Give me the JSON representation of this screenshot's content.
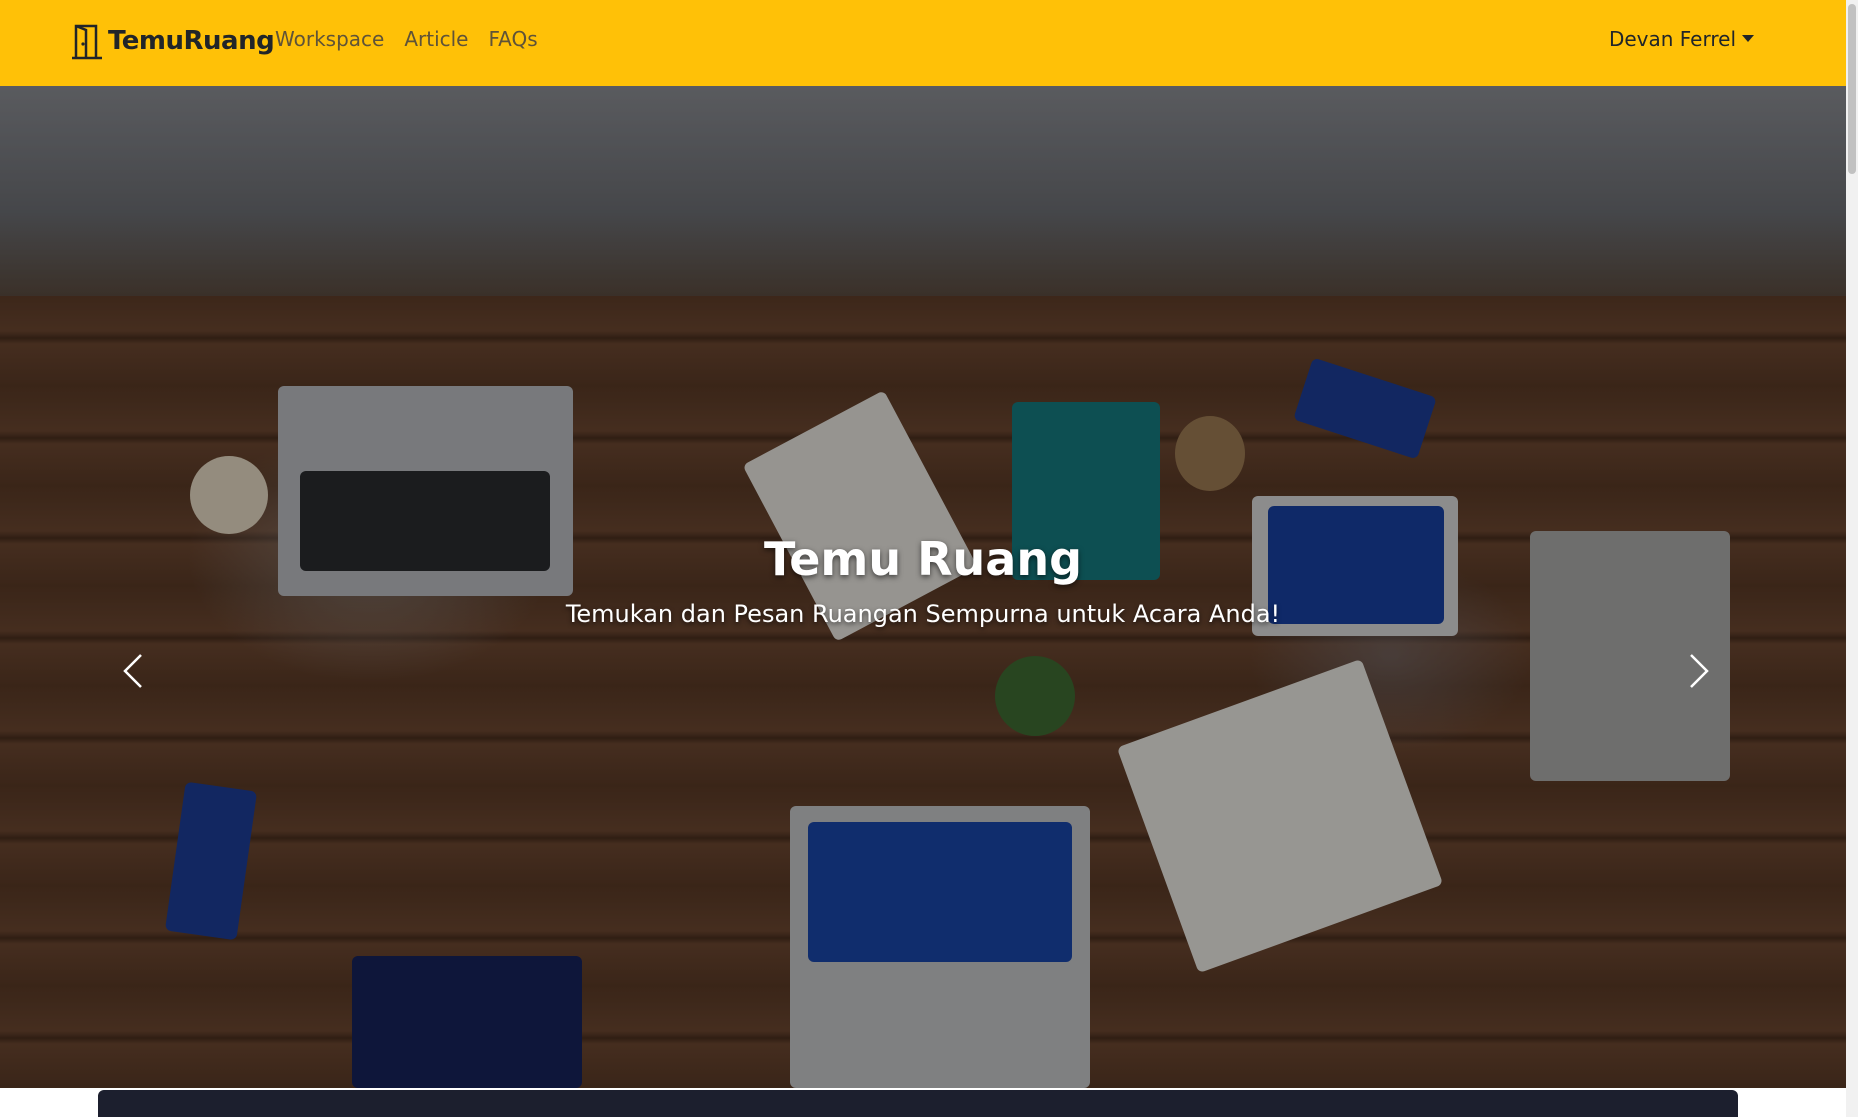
{
  "navbar": {
    "brand": "TemuRuang",
    "links": [
      "Workspace",
      "Article",
      "FAQs"
    ],
    "user": "Devan Ferrel",
    "brand_icon": "door-icon",
    "background": "#ffc107"
  },
  "hero": {
    "title": "Temu Ruang",
    "subtitle": "Temukan dan Pesan Ruangan Sempurna untuk Acara Anda!",
    "prev_icon": "chevron-left-icon",
    "next_icon": "chevron-right-icon",
    "slide_count": 2,
    "active_slide": 1
  },
  "colors": {
    "accent": "#ffc107",
    "footer": "#1c1f2e"
  }
}
